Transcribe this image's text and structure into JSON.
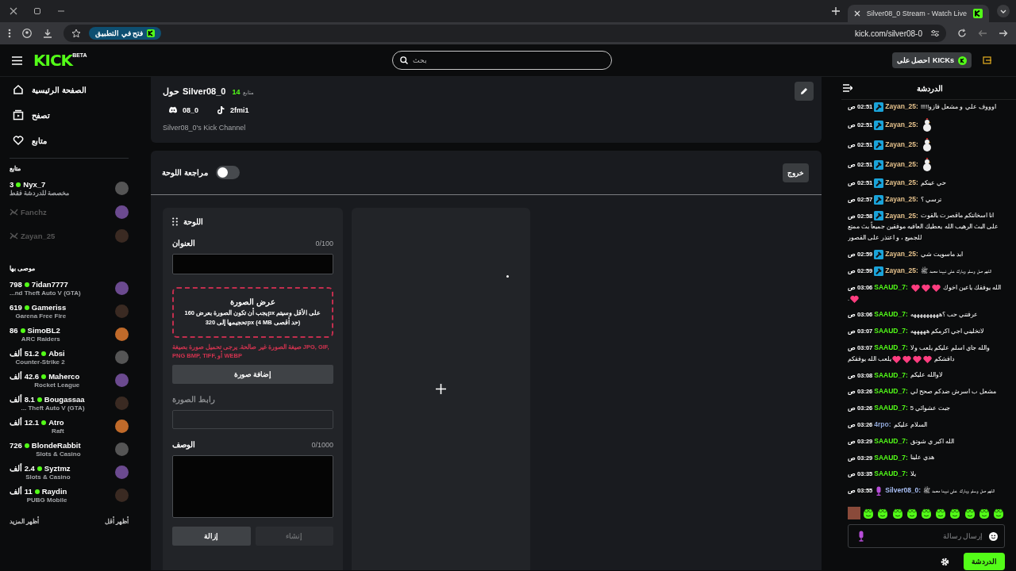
{
  "browser": {
    "tab_title": "Silver08_0 Stream - Watch Live",
    "url": "kick.com/silver08-0",
    "open_in_app": "فتح في التطبيق"
  },
  "header": {
    "logo": "KICK",
    "logo_badge": "BETA",
    "search": {
      "placeholder": "بحث"
    },
    "get_kicks": "احصل على KICKs"
  },
  "sidebar": {
    "nav": [
      {
        "kind": "home",
        "label": "الصفحة الرئيسية"
      },
      {
        "kind": "browse",
        "label": "تصفح"
      },
      {
        "kind": "following",
        "label": "متابع"
      }
    ],
    "following_title": "متابع",
    "following": [
      {
        "name": "Nyx_7",
        "live": true,
        "viewers": "3",
        "category": "مخصصة للدردشة فقط"
      },
      {
        "name": "Fanchz",
        "live": false
      },
      {
        "name": "Zayan_25",
        "live": false
      }
    ],
    "recommended_title": "موصى بها",
    "recommended": [
      {
        "name": "7idan7777",
        "live": true,
        "viewers": "798",
        "category": "...nd Theft Auto V (GTA)"
      },
      {
        "name": "Gameriss",
        "live": true,
        "viewers": "619",
        "category": "Garena Free Fire"
      },
      {
        "name": "SimoBL2",
        "live": true,
        "viewers": "86",
        "category": "ARC Raiders"
      },
      {
        "name": "Absi",
        "live": true,
        "viewers": "51.2 ألف",
        "category": "Counter-Strike 2"
      },
      {
        "name": "Maherco",
        "live": true,
        "viewers": "42.6 ألف",
        "category": "Rocket League"
      },
      {
        "name": "Bougassaa",
        "live": true,
        "viewers": "8.1 ألف",
        "category": "... Theft Auto V (GTA)"
      },
      {
        "name": "Atro",
        "live": true,
        "viewers": "12.1 ألف",
        "category": "Raft"
      },
      {
        "name": "BlondeRabbit",
        "live": true,
        "viewers": "726",
        "category": "Slots & Casino"
      },
      {
        "name": "Syztmz",
        "live": true,
        "viewers": "2.4 ألف",
        "category": "Slots & Casino"
      },
      {
        "name": "Raydin",
        "live": true,
        "viewers": "11 ألف",
        "category": "PUBG Mobile"
      }
    ],
    "show_more": "أظهر المزيد",
    "show_less": "أظهر أقل"
  },
  "about": {
    "about_word": "حول",
    "name": "Silver08_0",
    "followers": "14",
    "followers_label": "متابع",
    "socials": [
      {
        "kind": "tiktok",
        "handle": "2fmi1"
      },
      {
        "kind": "discord",
        "handle": "08_0"
      }
    ],
    "description": "Silver08_0's Kick Channel"
  },
  "panel_editor": {
    "exit": "خروج",
    "review": {
      "label": "مراجعة اللوحة",
      "on": false
    },
    "title": "اللوحة",
    "title_field": {
      "label": "العنوان",
      "counter": "0/100"
    },
    "image_drop": {
      "title": "عرض الصورة",
      "hint": "يجب أن تكون الصورة بعرض 160px على الأقل وسيتم تحجيمها إلى 320px (4 MB حد أقصى)"
    },
    "error": "صيغة الصورة غير صالحة. يرجى تحميل صورة بصيغة JPG, GIF, PNG BMP, TIFF, أو WEBP",
    "add_image": "إضافة صورة",
    "link_field": {
      "label": "رابط الصورة",
      "disabled": true
    },
    "description_field": {
      "label": "الوصف",
      "counter": "0/1000"
    },
    "buttons": [
      {
        "label": "إنشاء",
        "disabled": true
      },
      {
        "label": "إزالة",
        "disabled": false
      }
    ]
  },
  "chat": {
    "title": "الدردشة",
    "messages": [
      {
        "time": "02:51 ص",
        "kind": "moderator",
        "user": "Zayan_25:",
        "color": "#e8c48e",
        "content": [
          {
            "kind": "text",
            "text": "اوووف علي و مشعل فازو!!!!!"
          }
        ]
      },
      {
        "time": "02:51 ص",
        "kind": "moderator",
        "user": "Zayan_25:",
        "color": "#e8c48e",
        "content": [
          {
            "kind": "chicken"
          }
        ]
      },
      {
        "time": "02:51 ص",
        "kind": "moderator",
        "user": "Zayan_25:",
        "color": "#e8c48e",
        "content": [
          {
            "kind": "chicken"
          }
        ]
      },
      {
        "time": "02:51 ص",
        "kind": "moderator",
        "user": "Zayan_25:",
        "color": "#e8c48e",
        "content": [
          {
            "kind": "chicken"
          }
        ]
      },
      {
        "time": "02:51 ص",
        "kind": "moderator",
        "user": "Zayan_25:",
        "color": "#e8c48e",
        "content": [
          {
            "kind": "text",
            "text": "حي عينكم"
          }
        ]
      },
      {
        "time": "02:57 ص",
        "kind": "moderator",
        "user": "Zayan_25:",
        "color": "#e8c48e",
        "content": [
          {
            "kind": "text",
            "text": "ترسي ؟"
          }
        ]
      },
      {
        "time": "02:58 ص",
        "kind": "moderator",
        "user": "Zayan_25:",
        "color": "#e8c48e",
        "content": [
          {
            "kind": "text",
            "text": "انا اسخانتكم ماقصرت بالقوت على البث الرهيب الله يعطيك العافيه موفقين جميعاً بث ممتع للجميع ، و اعتذر على القصور"
          }
        ]
      },
      {
        "time": "02:59 ص",
        "kind": "moderator",
        "user": "Zayan_25:",
        "color": "#e8c48e",
        "content": [
          {
            "kind": "text",
            "text": "ابد ماسويت شي"
          }
        ]
      },
      {
        "time": "02:59 ص",
        "kind": "moderator",
        "user": "Zayan_25:",
        "color": "#e8c48e",
        "content": [
          {
            "kind": "text",
            "text": "اللهم صل وسلم وبارك على نبينا محمد ﷺ"
          }
        ]
      },
      {
        "time": "03:06 ص",
        "kind": "viewer",
        "user": "SAAUD_7:",
        "color": "#53fc18",
        "content": [
          {
            "kind": "text",
            "text": "الله يوفقك ياعين اخوك"
          },
          {
            "kind": "heart"
          },
          {
            "kind": "heart"
          },
          {
            "kind": "heart"
          },
          {
            "kind": "heart"
          },
          {
            "kind": "text",
            "text": "."
          }
        ]
      },
      {
        "time": "03:06 ص",
        "kind": "viewer",
        "user": "SAAUD_7:",
        "color": "#53fc18",
        "content": [
          {
            "kind": "text",
            "text": "عرفتني حب ؟هههههههههه"
          }
        ]
      },
      {
        "time": "03:07 ص",
        "kind": "viewer",
        "user": "SAAUD_7:",
        "color": "#53fc18",
        "content": [
          {
            "kind": "text",
            "text": "لاتخليني اجي اكرمكم هههههه"
          }
        ]
      },
      {
        "time": "03:07 ص",
        "kind": "viewer",
        "user": "SAAUD_7:",
        "color": "#53fc18",
        "content": [
          {
            "kind": "text",
            "text": "والله جاي اسلم عليكم يلعب ولا دافشكم"
          },
          {
            "kind": "heart"
          },
          {
            "kind": "heart"
          },
          {
            "kind": "heart"
          },
          {
            "kind": "heart"
          },
          {
            "kind": "text",
            "text": "يلعب الله يوفقكم"
          }
        ]
      },
      {
        "time": "03:08 ص",
        "kind": "viewer",
        "user": "SAAUD_7:",
        "color": "#53fc18",
        "content": [
          {
            "kind": "text",
            "text": "لاوالله عليكم"
          }
        ]
      },
      {
        "time": "03:26 ص",
        "kind": "viewer",
        "user": "SAAUD_7:",
        "color": "#53fc18",
        "content": [
          {
            "kind": "text",
            "text": "مشعل ب اسرش ضدكم صحح لي"
          }
        ]
      },
      {
        "time": "03:26 ص",
        "kind": "viewer",
        "user": "SAAUD_7:",
        "color": "#53fc18",
        "content": [
          {
            "kind": "text",
            "text": "جبت عشوائي 5"
          }
        ]
      },
      {
        "time": "03:26 ص",
        "kind": "viewer",
        "user": "4rpo:",
        "color": "#8fa6d6",
        "content": [
          {
            "kind": "text",
            "text": "السلام عليكم"
          }
        ]
      },
      {
        "time": "03:29 ص",
        "kind": "viewer",
        "user": "SAAUD_7:",
        "color": "#53fc18",
        "content": [
          {
            "kind": "text",
            "text": "الله اكبر ي شوتق"
          }
        ]
      },
      {
        "time": "03:29 ص",
        "kind": "viewer",
        "user": "SAAUD_7:",
        "color": "#53fc18",
        "content": [
          {
            "kind": "text",
            "text": "هدي علينا"
          }
        ]
      },
      {
        "time": "03:35 ص",
        "kind": "viewer",
        "user": "SAAUD_7:",
        "color": "#53fc18",
        "content": [
          {
            "kind": "text",
            "text": "يلا"
          }
        ]
      },
      {
        "time": "03:55 ص",
        "kind": "broadcaster",
        "user": "Silver08_0:",
        "color": "#a9bff5",
        "content": [
          {
            "kind": "text",
            "text": "اللهم صل وسلم وبارك على نبينا محمد ﷺ"
          }
        ]
      }
    ],
    "input": {
      "placeholder": "إرسال رسالة"
    },
    "send": "الدردشة"
  }
}
